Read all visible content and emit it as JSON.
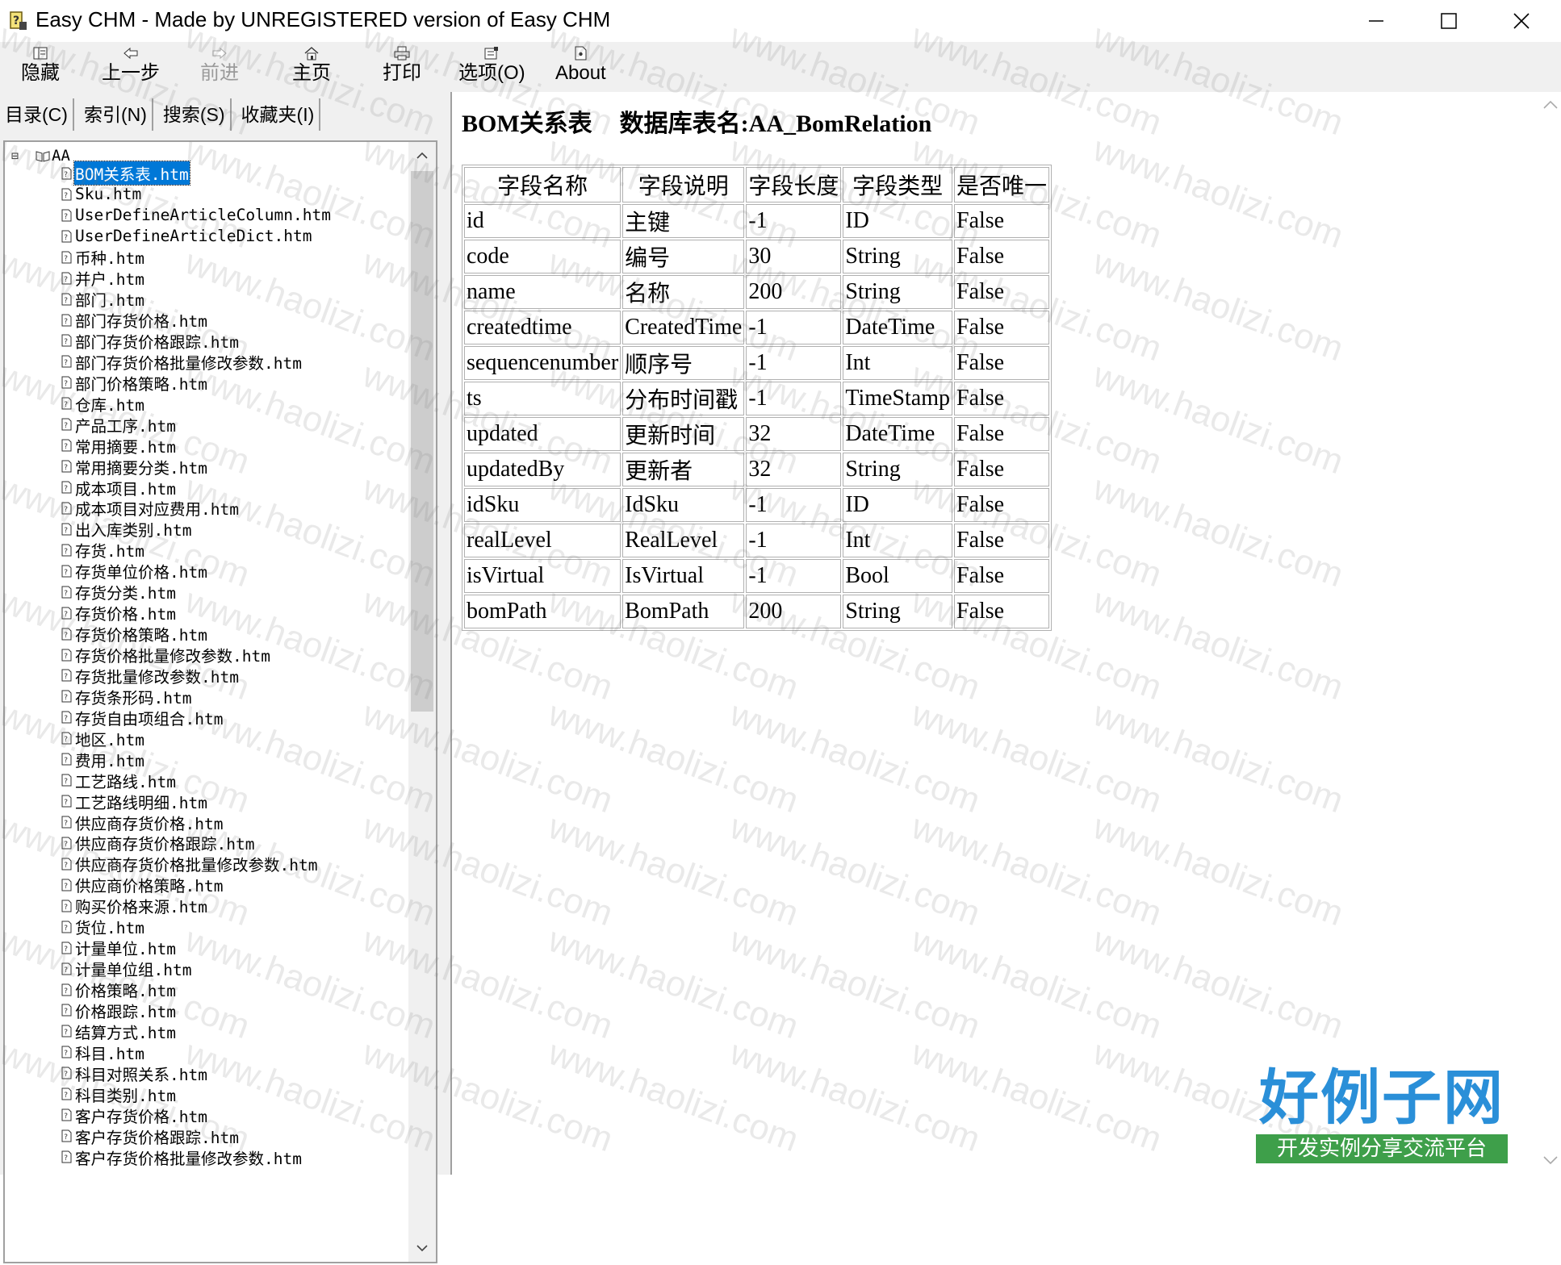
{
  "window": {
    "title": "Easy CHM - Made by UNREGISTERED version of Easy CHM"
  },
  "toolbar": {
    "buttons": [
      {
        "label": "隐藏",
        "icon": "hide-icon",
        "enabled": true
      },
      {
        "label": "上一步",
        "icon": "back-arrow-icon",
        "enabled": true
      },
      {
        "label": "前进",
        "icon": "forward-arrow-icon",
        "enabled": false
      },
      {
        "label": "主页",
        "icon": "home-icon",
        "enabled": true
      },
      {
        "label": "打印",
        "icon": "printer-icon",
        "enabled": true
      },
      {
        "label": "选项(O)",
        "icon": "options-icon",
        "enabled": true
      },
      {
        "label": "About",
        "icon": "about-icon",
        "enabled": true
      }
    ]
  },
  "nav_tabs": [
    "目录(C)",
    "索引(N)",
    "搜索(S)",
    "收藏夹(I)"
  ],
  "tree": {
    "root": "AA",
    "selected_index": 0,
    "items": [
      "BOM关系表.htm",
      "Sku.htm",
      "UserDefineArticleColumn.htm",
      "UserDefineArticleDict.htm",
      "币种.htm",
      "并户.htm",
      "部门.htm",
      "部门存货价格.htm",
      "部门存货价格跟踪.htm",
      "部门存货价格批量修改参数.htm",
      "部门价格策略.htm",
      "仓库.htm",
      "产品工序.htm",
      "常用摘要.htm",
      "常用摘要分类.htm",
      "成本项目.htm",
      "成本项目对应费用.htm",
      "出入库类别.htm",
      "存货.htm",
      "存货单位价格.htm",
      "存货分类.htm",
      "存货价格.htm",
      "存货价格策略.htm",
      "存货价格批量修改参数.htm",
      "存货批量修改参数.htm",
      "存货条形码.htm",
      "存货自由项组合.htm",
      "地区.htm",
      "费用.htm",
      "工艺路线.htm",
      "工艺路线明细.htm",
      "供应商存货价格.htm",
      "供应商存货价格跟踪.htm",
      "供应商存货价格批量修改参数.htm",
      "供应商价格策略.htm",
      "购买价格来源.htm",
      "货位.htm",
      "计量单位.htm",
      "计量单位组.htm",
      "价格策略.htm",
      "价格跟踪.htm",
      "结算方式.htm",
      "科目.htm",
      "科目对照关系.htm",
      "科目类别.htm",
      "客户存货价格.htm",
      "客户存货价格跟踪.htm",
      "客户存货价格批量修改参数.htm"
    ]
  },
  "document": {
    "title_left": "BOM关系表",
    "title_right": "数据库表名:AA_BomRelation",
    "columns": [
      "字段名称",
      "字段说明",
      "字段长度",
      "字段类型",
      "是否唯一"
    ],
    "rows": [
      [
        "id",
        "主键",
        "-1",
        "ID",
        "False"
      ],
      [
        "code",
        "编号",
        "30",
        "String",
        "False"
      ],
      [
        "name",
        "名称",
        "200",
        "String",
        "False"
      ],
      [
        "createdtime",
        "CreatedTime",
        "-1",
        "DateTime",
        "False"
      ],
      [
        "sequencenumber",
        "顺序号",
        "-1",
        "Int",
        "False"
      ],
      [
        "ts",
        "分布时间戳",
        "-1",
        "TimeStamp",
        "False"
      ],
      [
        "updated",
        "更新时间",
        "32",
        "DateTime",
        "False"
      ],
      [
        "updatedBy",
        "更新者",
        "32",
        "String",
        "False"
      ],
      [
        "idSku",
        "IdSku",
        "-1",
        "ID",
        "False"
      ],
      [
        "realLevel",
        "RealLevel",
        "-1",
        "Int",
        "False"
      ],
      [
        "isVirtual",
        "IsVirtual",
        "-1",
        "Bool",
        "False"
      ],
      [
        "bomPath",
        "BomPath",
        "200",
        "String",
        "False"
      ]
    ]
  },
  "watermark": {
    "text": "www.haolizi.com",
    "brand_title": "好例子网",
    "brand_subtitle": "开发实例分享交流平台"
  },
  "colors": {
    "selection": "#0078d7",
    "brand_blue": "#2a8fd8",
    "brand_green": "#3e9f4a"
  }
}
